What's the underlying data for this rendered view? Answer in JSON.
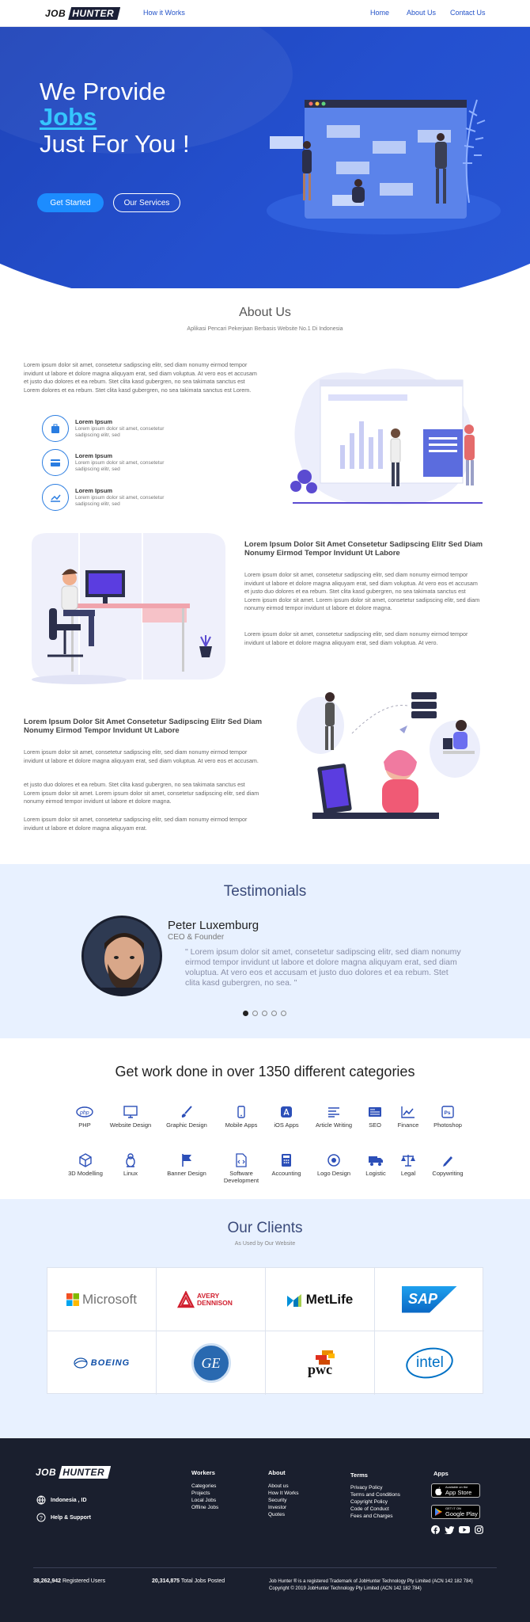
{
  "nav": {
    "logo_left": "JOB",
    "logo_right": "HUNTER",
    "how_it_works": "How it Works",
    "home": "Home",
    "about": "About Us",
    "contact": "Contact Us"
  },
  "hero": {
    "line1": "We Provide",
    "jobs": "Jobs",
    "line3": "Just For You !",
    "get_started": "Get Started",
    "our_services": "Our Services"
  },
  "about": {
    "title": "About Us",
    "subtitle": "Aplikasi Pencari Pekerjaan Berbasis Website No.1 Di Indonesia",
    "intro": "Lorem ipsum dolor sit amet, consetetur sadipscing elitr, sed diam nonumy eirmod tempor invidunt ut labore et dolore magna aliquyam erat, sed diam voluptua. At vero eos et accusam et justo duo dolores et ea rebum. Stet clita kasd gubergren, no sea takimata sanctus est Lorem dolores et ea rebum. Stet clita kasd gubergren, no sea takimata sanctus est Lorem.",
    "features": [
      {
        "title": "Lorem Ipsum",
        "desc": "Lorem ipsum dolor sit amet, consetetur sadipscing elitr, sed"
      },
      {
        "title": "Lorem Ipsum",
        "desc": "Lorem ipsum dolor sit amet, consetetur sadipscing elitr, sed"
      },
      {
        "title": "Lorem Ipsum",
        "desc": "Lorem ipsum dolor sit amet, consetetur sadipscing elitr, sed"
      }
    ]
  },
  "block2": {
    "heading": "Lorem Ipsum Dolor Sit Amet Consetetur Sadipscing Elitr Sed Diam Nonumy Eirmod Tempor Invidunt Ut Labore",
    "p1": "Lorem ipsum dolor sit amet, consetetur sadipscing elitr, sed diam nonumy eirmod tempor invidunt ut labore et dolore magna aliquyam erat, sed diam voluptua. At vero eos et accusam et justo duo dolores et ea rebum. Stet clita kasd gubergren, no sea takimata sanctus est Lorem ipsum dolor sit amet. Lorem ipsum dolor sit amet, consetetur sadipscing elitr, sed diam nonumy eirmod tempor invidunt ut labore et dolore magna.",
    "p2": "Lorem ipsum dolor sit amet, consetetur sadipscing elitr, sed diam nonumy eirmod tempor invidunt ut labore et dolore magna aliquyam erat, sed diam voluptua. At vero."
  },
  "block3": {
    "heading": "Lorem Ipsum Dolor Sit Amet Consetetur Sadipscing Elitr Sed Diam Nonumy Eirmod Tempor Invidunt Ut Labore",
    "p1": "Lorem ipsum dolor sit amet, consetetur sadipscing elitr, sed diam nonumy eirmod tempor invidunt ut labore et dolore magna aliquyam erat, sed diam voluptua. At vero eos et accusam.",
    "p2": "et justo duo dolores et ea rebum. Stet clita kasd gubergren, no sea takimata sanctus est Lorem ipsum dolor sit amet. Lorem ipsum dolor sit amet, consetetur sadipscing elitr, sed diam nonumy eirmod tempor invidunt ut labore et dolore magna.",
    "p3": "Lorem ipsum dolor sit amet, consetetur sadipscing elitr, sed diam nonumy eirmod tempor invidunt ut labore et dolore magna aliquyam erat."
  },
  "testimonials": {
    "title": "Testimonials",
    "name": "Peter Luxemburg",
    "role": "CEO & Founder",
    "quote": "\" Lorem ipsum dolor sit amet, consetetur sadipscing elitr, sed diam nonumy eirmod tempor invidunt ut labore et dolore magna aliquyam erat, sed diam voluptua. At vero eos et accusam et justo duo dolores et ea rebum. Stet clita kasd gubergren, no sea. \"",
    "active_dot": 1,
    "dot_count": 5
  },
  "categories": {
    "title": "Get work done in over 1350 different categories",
    "row1": [
      "PHP",
      "Website Design",
      "Graphic Design",
      "Mobile Apps",
      "iOS Apps",
      "Article Writing",
      "SEO",
      "Finance",
      "Photoshop"
    ],
    "row2": [
      "3D Modelling",
      "Linux",
      "Banner Design",
      "Software Development",
      "Accounting",
      "Logo Design",
      "Logistic",
      "Legal",
      "Copywriting"
    ]
  },
  "clients": {
    "title": "Our Clients",
    "subtitle": "As Used by Our Website",
    "logos": [
      "Microsoft",
      "AVERY DENNISON",
      "MetLife",
      "SAP",
      "BOEING",
      "GE",
      "pwc",
      "intel"
    ]
  },
  "footer": {
    "logo_left": "JOB",
    "logo_right": "HUNTER",
    "location": "Indonesia , ID",
    "help": "Help & Support",
    "workers_title": "Workers",
    "workers": [
      "Categories",
      "Projects",
      "Local Jobs",
      "Offline Jobs"
    ],
    "about_title": "About",
    "about": [
      "About us",
      "How It Works",
      "Security",
      "Investor",
      "Quotes"
    ],
    "terms_title": "Terms",
    "terms": [
      "Privacy Policy",
      "Terms and Conditions",
      "Copyright Policy",
      "Code of Conduct",
      "Fees and Charges"
    ],
    "apps_title": "Apps",
    "appstore_small": "Available on the",
    "appstore": "App Store",
    "googleplay_small": "GET IT ON",
    "googleplay": "Google Play",
    "registered_num": "38,262,942",
    "registered_label": "Registered Users",
    "jobs_num": "20,314,875",
    "jobs_label": "Total Jobs Posted",
    "trademark": "Job Hunter ® is a registered Trademark of JobHunter Technology Pty Limited (ACN 142 182 784)",
    "copyright": "Copyright © 2019 JobHunter Technology Pty Limited (ACN 142 182 784)"
  },
  "colors": {
    "primary": "#2450cf",
    "accent": "#35c6ff",
    "button": "#1c8cff",
    "footer": "#1a1f2e",
    "light": "#e8f1ff"
  }
}
